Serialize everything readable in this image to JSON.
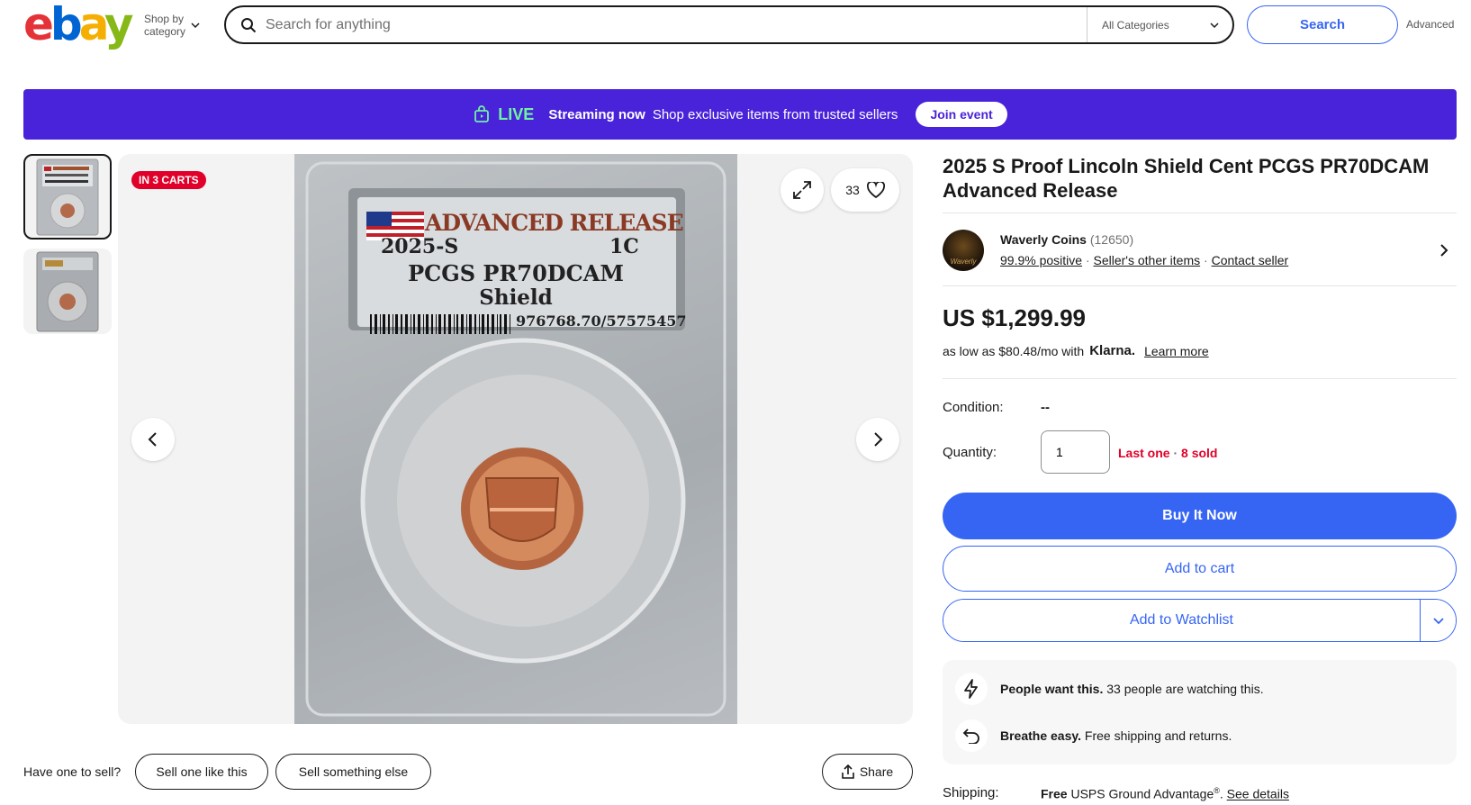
{
  "header": {
    "logo": [
      "e",
      "b",
      "a",
      "y"
    ],
    "shop_by_line1": "Shop by",
    "shop_by_line2": "category",
    "search_placeholder": "Search for anything",
    "category": "All Categories",
    "search_button": "Search",
    "advanced": "Advanced"
  },
  "banner": {
    "live": "LIVE",
    "streaming": "Streaming now",
    "text": "Shop exclusive items from trusted sellers",
    "join": "Join event"
  },
  "gallery": {
    "badge": "IN 3 CARTS",
    "watch_count": "33",
    "label_advanced": "ADVANCED RELEASE",
    "label_year": "2025-S",
    "label_denom": "1C",
    "label_grade": "PCGS PR70DCAM",
    "label_variety": "Shield",
    "label_cert": "976768.70/57575457"
  },
  "bottom": {
    "have_one": "Have one to sell?",
    "sell_like": "Sell one like this",
    "sell_else": "Sell something else",
    "share": "Share"
  },
  "item": {
    "title": "2025 S Proof Lincoln Shield Cent PCGS PR70DCAM Advanced Release",
    "seller_name": "Waverly Coins",
    "seller_feedback": "(12650)",
    "seller_positive": "99.9% positive",
    "seller_other": "Seller's other items",
    "seller_contact": "Contact seller",
    "avatar_text": "Waverly",
    "price": "US $1,299.99",
    "klarna_prefix": "as low as $80.48/mo with",
    "klarna_brand": "Klarna.",
    "klarna_link": "Learn more",
    "condition_label": "Condition:",
    "condition_value": "--",
    "quantity_label": "Quantity:",
    "quantity_value": "1",
    "last_one": "Last one",
    "sold": "8 sold",
    "buy_now": "Buy It Now",
    "add_to_cart": "Add to cart",
    "add_to_watchlist": "Add to Watchlist",
    "signal1_bold": "People want this.",
    "signal1_text": "33 people are watching this.",
    "signal2_bold": "Breathe easy.",
    "signal2_text": "Free shipping and returns.",
    "shipping_label": "Shipping:",
    "shipping_free": "Free",
    "shipping_text": "USPS Ground Advantage",
    "shipping_reg": "®",
    "shipping_link": "See details"
  },
  "colors": {
    "primary": "#3665f3",
    "banner": "#4923d9",
    "live": "#6ff3a2",
    "urgent": "#e0002a"
  }
}
